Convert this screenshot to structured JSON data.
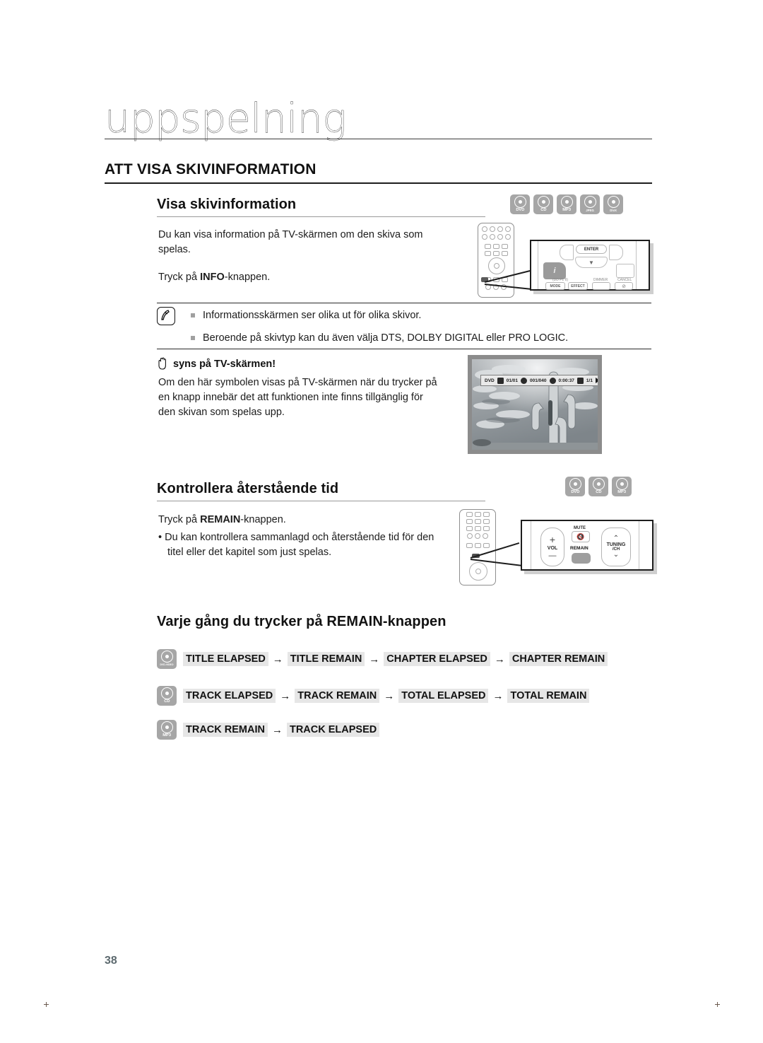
{
  "page": {
    "number": "38",
    "chapter_title": "uppspelning",
    "h1": "ATT VISA SKIVINFORMATION"
  },
  "section_disc_info": {
    "heading": "Visa skivinformation",
    "badges": [
      {
        "label": "DVD",
        "name": "dvd"
      },
      {
        "label": "CD",
        "name": "cd"
      },
      {
        "label": "MP3",
        "name": "mp3"
      },
      {
        "label": "JPEG",
        "name": "jpeg"
      },
      {
        "label": "DivX",
        "name": "divx"
      }
    ],
    "paragraph_1": "Du kan visa information på TV-skärmen om den skiva som spelas.",
    "paragraph_2_prefix": "Tryck på ",
    "paragraph_2_bold": "INFO",
    "paragraph_2_suffix": "-knappen."
  },
  "note_box": {
    "icon": "note-pen-icon",
    "items": [
      "Informationsskärmen ser olika ut för olika skivor.",
      "Beroende på skivtyp kan du även välja DTS, DOLBY DIGITAL eller PRO LOGIC."
    ]
  },
  "hand_note": {
    "icon": "hand-icon",
    "heading": "syns på TV-skärmen!",
    "paragraph": "Om den här symbolen visas på TV-skärmen när du trycker på en knapp innebär det att funktionen inte finns tillgänglig för den skivan som spelas upp."
  },
  "tv_screenshot": {
    "name": "tv-screen-cactus-photo",
    "osd": {
      "disc_type": "DVD",
      "title": "01/01",
      "chapter": "001/040",
      "time": "0:00:37",
      "audio": "1/1",
      "play_state": "play-icon"
    }
  },
  "remote_info": {
    "buttons": {
      "enter": "ENTER",
      "info": "INFO",
      "group": "(DD PL II)",
      "mode": "MODE",
      "effect": "EFFECT",
      "dimmer": "DIMMER",
      "cancel": "CANCEL"
    }
  },
  "section_remaining": {
    "heading": "Kontrollera återstående tid",
    "badges": [
      {
        "label": "DVD",
        "name": "dvd"
      },
      {
        "label": "CD",
        "name": "cd"
      },
      {
        "label": "MP3",
        "name": "mp3"
      }
    ],
    "line_1_prefix": "Tryck på ",
    "line_1_bold": "REMAIN",
    "line_1_suffix": "-knappen.",
    "bullet": "Du kan kontrollera sammanlagd och återstående tid för den titel eller det kapitel som just spelas."
  },
  "remote_remain": {
    "buttons": {
      "vol": "VOL",
      "vol_plus": "+",
      "vol_minus": "—",
      "mute": "MUTE",
      "remain": "REMAIN",
      "tuning": "TUNING",
      "tuning_sub": "/CH"
    }
  },
  "section_sequence": {
    "heading": "Varje gång du trycker på REMAIN-knappen",
    "rows": [
      {
        "badge": "DVD-VIDEO",
        "badge_name": "dvd-video",
        "terms": [
          "TITLE ELAPSED",
          "TITLE REMAIN",
          "CHAPTER ELAPSED",
          "CHAPTER REMAIN"
        ]
      },
      {
        "badge": "CD",
        "badge_name": "cd",
        "terms": [
          "TRACK ELAPSED",
          "TRACK REMAIN",
          "TOTAL ELAPSED",
          "TOTAL REMAIN"
        ]
      },
      {
        "badge": "MP3",
        "badge_name": "mp3",
        "terms": [
          "TRACK REMAIN",
          "TRACK ELAPSED"
        ]
      }
    ],
    "arrow": "→"
  },
  "colors": {
    "badge_gray": "#a6a6a6",
    "term_highlight": "#e6e6e6",
    "page_number": "#5d6a6f",
    "rule_dark": "#1d1d1d",
    "rule_light": "#9a9a9a"
  }
}
